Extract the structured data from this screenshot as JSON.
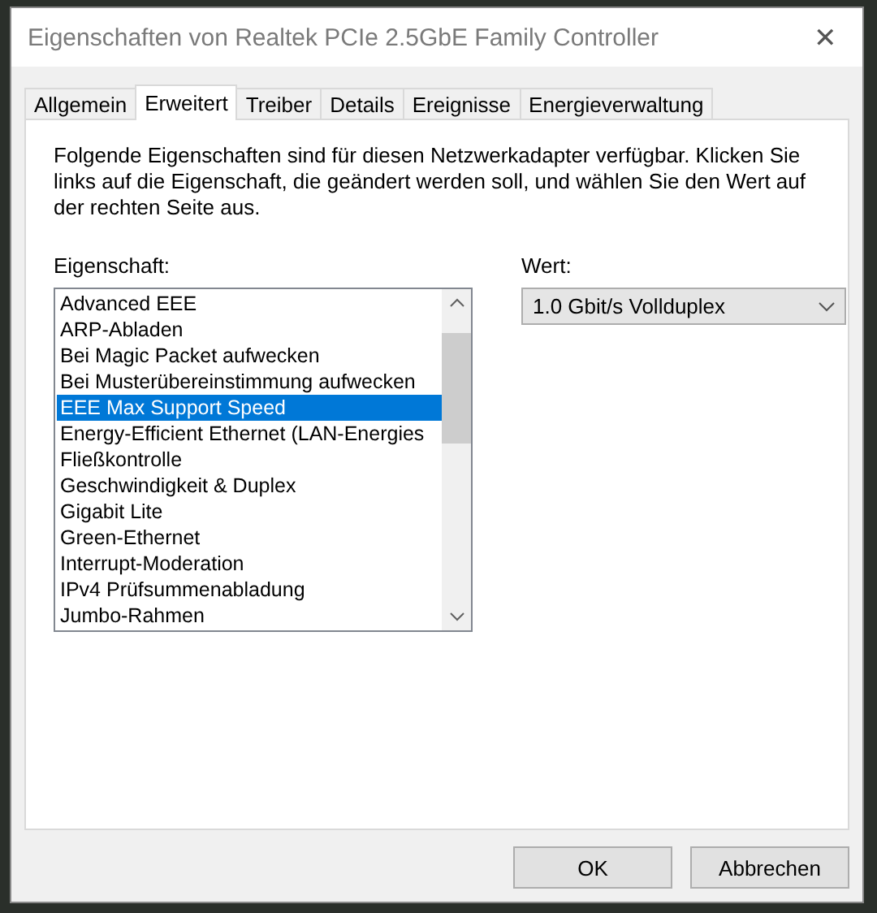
{
  "window": {
    "title": "Eigenschaften von Realtek PCIe 2.5GbE Family Controller",
    "close": "✕"
  },
  "tabs": [
    {
      "label": "Allgemein",
      "selected": false
    },
    {
      "label": "Erweitert",
      "selected": true
    },
    {
      "label": "Treiber",
      "selected": false
    },
    {
      "label": "Details",
      "selected": false
    },
    {
      "label": "Ereignisse",
      "selected": false
    },
    {
      "label": "Energieverwaltung",
      "selected": false
    }
  ],
  "description": "Folgende Eigenschaften sind für diesen Netzwerkadapter verfügbar. Klicken Sie links auf die Eigenschaft, die geändert werden soll, und wählen Sie den Wert auf der rechten Seite aus.",
  "property_label": "Eigenschaft:",
  "properties": [
    {
      "label": "Advanced EEE",
      "selected": false
    },
    {
      "label": "ARP-Abladen",
      "selected": false
    },
    {
      "label": "Bei Magic Packet aufwecken",
      "selected": false
    },
    {
      "label": "Bei Musterübereinstimmung aufwecken",
      "selected": false
    },
    {
      "label": "EEE Max Support Speed",
      "selected": true
    },
    {
      "label": "Energy-Efficient Ethernet (LAN-Energies",
      "selected": false
    },
    {
      "label": "Fließkontrolle",
      "selected": false
    },
    {
      "label": "Geschwindigkeit & Duplex",
      "selected": false
    },
    {
      "label": "Gigabit Lite",
      "selected": false
    },
    {
      "label": "Green-Ethernet",
      "selected": false
    },
    {
      "label": "Interrupt-Moderation",
      "selected": false
    },
    {
      "label": "IPv4 Prüfsummenabladung",
      "selected": false
    },
    {
      "label": "Jumbo-Rahmen",
      "selected": false
    }
  ],
  "value_label": "Wert:",
  "value": "1.0 Gbit/s Vollduplex",
  "buttons": [
    "OK",
    "Abbrechen"
  ]
}
